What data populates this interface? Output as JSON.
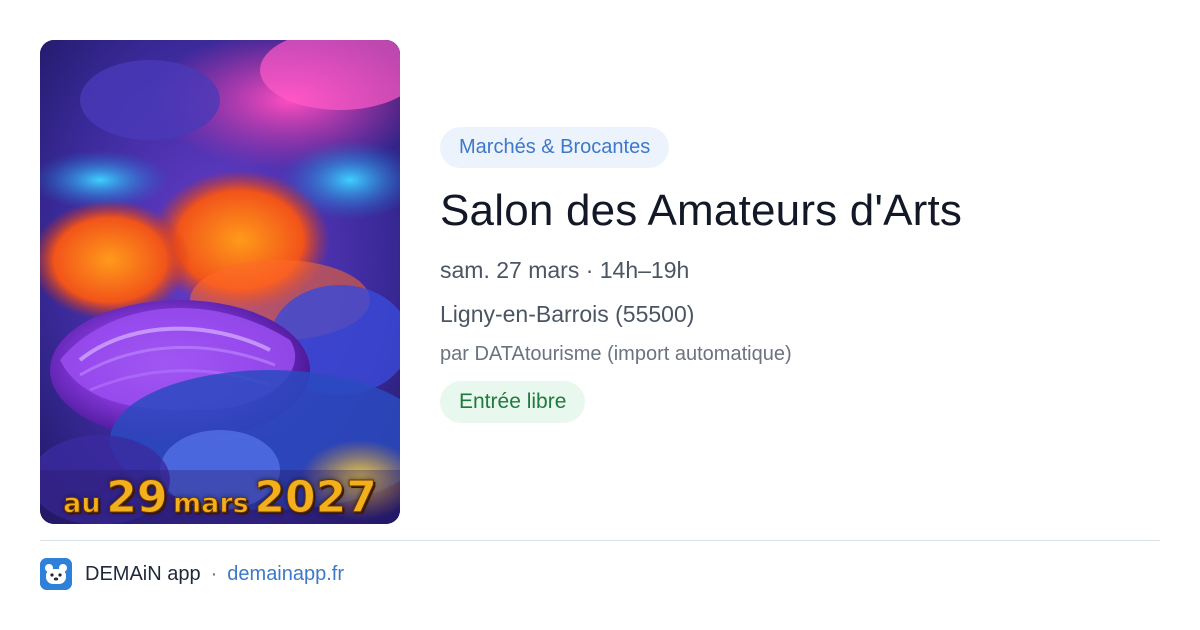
{
  "poster": {
    "caption_prefix": "au",
    "caption_day": "29",
    "caption_month": "mars",
    "caption_year": "2027"
  },
  "event": {
    "category": "Marchés & Brocantes",
    "title": "Salon des Amateurs d'Arts",
    "when": "sam. 27 mars · 14h–19h",
    "where": "Ligny-en-Barrois (55500)",
    "source": "par DATAtourisme (import automatique)",
    "price": "Entrée libre"
  },
  "footer": {
    "app_icon": "bear-app-icon",
    "app_name": "DEMAiN app",
    "separator": "·",
    "site": "demainapp.fr"
  },
  "colors": {
    "category_bg": "#edf3fc",
    "category_text": "#3d78c9",
    "price_bg": "#e9f8ee",
    "price_text": "#1f7a3d",
    "title_text": "#121826",
    "link": "#3d78c9"
  }
}
